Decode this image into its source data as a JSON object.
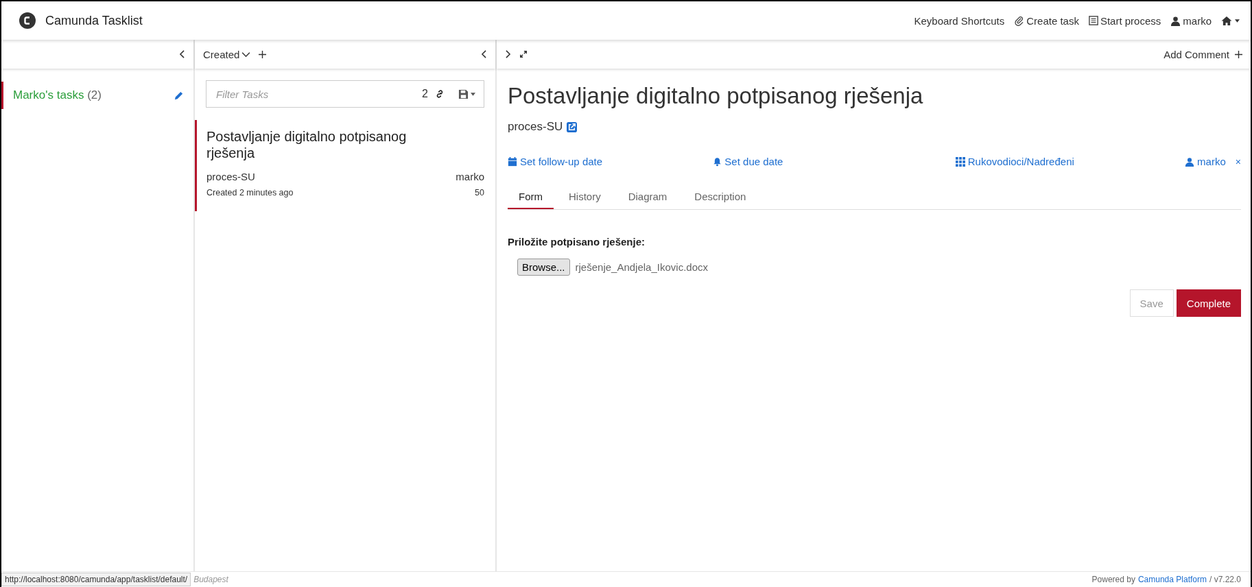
{
  "header": {
    "title": "Camunda Tasklist",
    "nav": [
      {
        "kind": "shortcuts",
        "label": "Keyboard Shortcuts"
      },
      {
        "kind": "create",
        "label": "Create task"
      },
      {
        "kind": "start",
        "label": "Start process"
      }
    ],
    "user": "marko"
  },
  "filters": [
    {
      "name": "Marko's tasks",
      "count": "(2)",
      "selected": true
    }
  ],
  "list": {
    "sort": "Created",
    "search": {
      "placeholder": "Filter Tasks",
      "count": "2"
    },
    "tasks": [
      {
        "title": "Postavljanje digitalno potpisanog rješenja",
        "process": "proces-SU",
        "assignee": "marko",
        "created": "Created 2 minutes ago",
        "priority": "50",
        "selected": true
      }
    ]
  },
  "detail": {
    "add_comment": "Add Comment",
    "title": "Postavljanje digitalno potpisanog rješenja",
    "process": "proces-SU",
    "actions": [
      {
        "kind": "follow-up",
        "label": "Set follow-up date"
      },
      {
        "kind": "due",
        "label": "Set due date"
      },
      {
        "kind": "groups",
        "label": "Rukovodioci/Nadređeni"
      },
      {
        "kind": "assignee",
        "label": "marko",
        "remove": "×"
      }
    ],
    "tabs": [
      {
        "label": "Form",
        "selected": true
      },
      {
        "label": "History",
        "selected": false
      },
      {
        "label": "Diagram",
        "selected": false
      },
      {
        "label": "Description",
        "selected": false
      }
    ],
    "form": {
      "label": "Priložite potpisano rješenje:",
      "browse": "Browse...",
      "file": "rješenje_Andjela_Ikovic.docx"
    },
    "buttons": {
      "save": "Save",
      "complete": "Complete"
    }
  },
  "footer": {
    "url": "http://localhost:8080/camunda/app/tasklist/default/",
    "timezone": "Budapest",
    "powered": "Powered by",
    "link": "Camunda Platform",
    "version": "/ v7.22.0"
  }
}
